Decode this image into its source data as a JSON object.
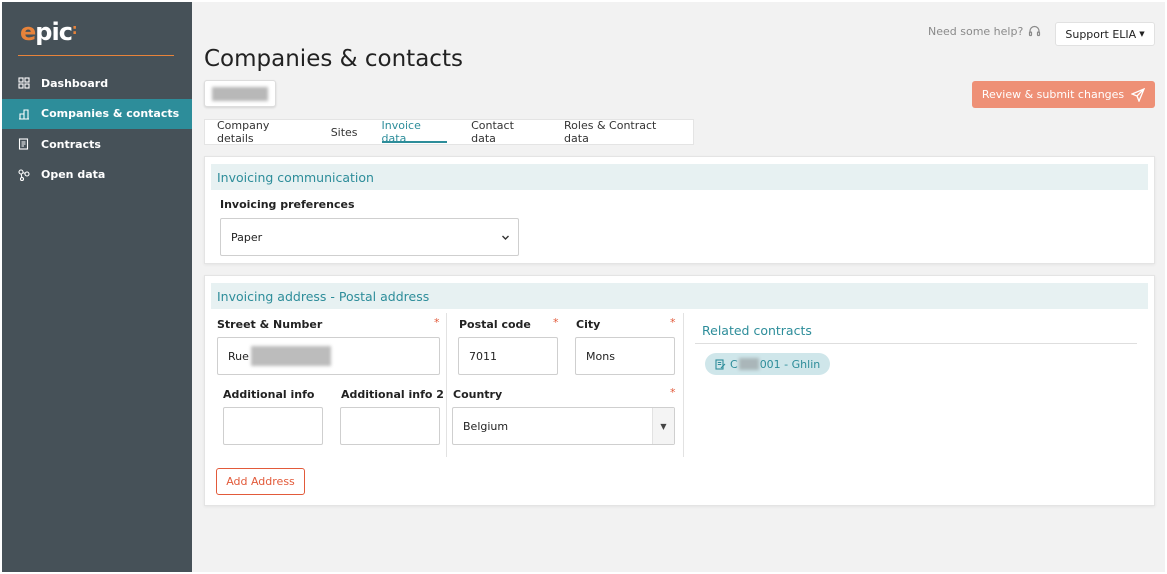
{
  "sidebar": {
    "logo": {
      "part1": "e",
      "part2": "pic",
      "part3": ":"
    },
    "items": [
      {
        "label": "Dashboard",
        "icon": "dashboard-icon",
        "active": false
      },
      {
        "label": "Companies & contacts",
        "icon": "companies-icon",
        "active": true
      },
      {
        "label": "Contracts",
        "icon": "contracts-icon",
        "active": false
      },
      {
        "label": "Open data",
        "icon": "open-data-icon",
        "active": false
      }
    ]
  },
  "header": {
    "help_text": "Need some help?",
    "support_label": "Support ELIA",
    "page_title": "Companies & contacts",
    "submit_label": "Review & submit changes"
  },
  "tabs": [
    {
      "label": "Company details",
      "active": false
    },
    {
      "label": "Sites",
      "active": false
    },
    {
      "label": "Invoice data",
      "active": true
    },
    {
      "label": "Contact data",
      "active": false
    },
    {
      "label": "Roles & Contract data",
      "active": false
    }
  ],
  "invoicing_communication": {
    "title": "Invoicing communication",
    "preferences_label": "Invoicing preferences",
    "preferences_value": "Paper"
  },
  "invoicing_address": {
    "title": "Invoicing address - Postal address",
    "street_label": "Street & Number",
    "street_value_prefix": "Rue",
    "postal_label": "Postal code",
    "postal_value": "7011",
    "city_label": "City",
    "city_value": "Mons",
    "additional_info_label": "Additional info",
    "additional_info_value": "",
    "additional_info2_label": "Additional info 2",
    "additional_info2_value": "",
    "country_label": "Country",
    "country_value": "Belgium",
    "required_mark": "*",
    "add_address_label": "Add Address"
  },
  "related_contracts": {
    "title": "Related contracts",
    "items": [
      {
        "prefix": "C",
        "suffix": "001 - Ghlin"
      }
    ]
  },
  "colors": {
    "accent_teal": "#2d8d9a",
    "accent_orange": "#e8833a",
    "submit_bg": "#ee9076",
    "sidebar_bg": "#465158",
    "required_red": "#e25a3a"
  }
}
